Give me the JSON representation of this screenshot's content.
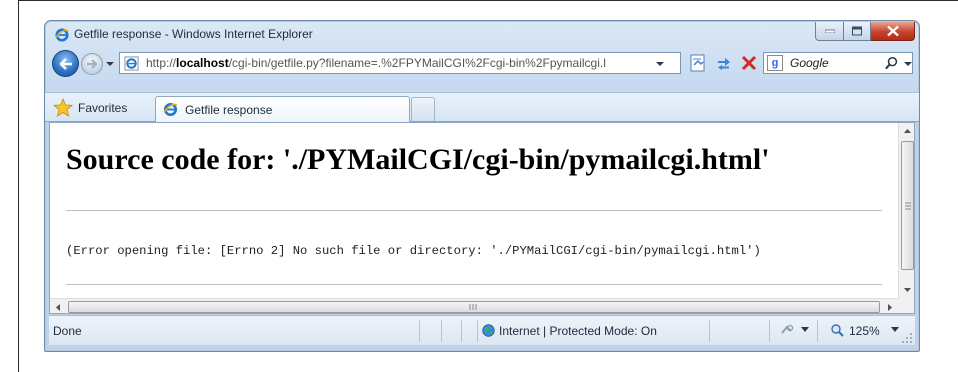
{
  "window": {
    "title": "Getfile response - Windows Internet Explorer"
  },
  "address_bar": {
    "url_prefix": "http://",
    "url_host": "localhost",
    "url_rest": "/cgi-bin/getfile.py?filename=.%2FPYMailCGI%2Fcgi-bin%2Fpymailcgi.l"
  },
  "search": {
    "placeholder": "Google",
    "provider_letter": "g"
  },
  "favorites_bar": {
    "favorites_label": "Favorites"
  },
  "tabs": [
    {
      "label": "Getfile response",
      "active": true
    }
  ],
  "page": {
    "heading": "Source code for: './PYMailCGI/cgi-bin/pymailcgi.html'",
    "error_message": "(Error opening file: [Errno 2] No such file or directory: './PYMailCGI/cgi-bin/pymailcgi.html')"
  },
  "status_bar": {
    "status": "Done",
    "zone": "Internet | Protected Mode: On",
    "zoom": "125%"
  },
  "icons": {
    "window": "ie-logo-icon",
    "back": "back-arrow-icon",
    "forward": "forward-arrow-icon",
    "compat": "compatibility-view-icon",
    "refresh": "refresh-icon",
    "stop": "stop-icon",
    "search": "search-icon",
    "favorites": "favorites-star-icon",
    "zone": "globe-icon",
    "zoom": "magnifier-icon"
  },
  "colors": {
    "chrome": "#c8dbf0",
    "close_button": "#c7432c",
    "back_button": "#2a6fc3",
    "ie_logo": "#1e79d6"
  }
}
